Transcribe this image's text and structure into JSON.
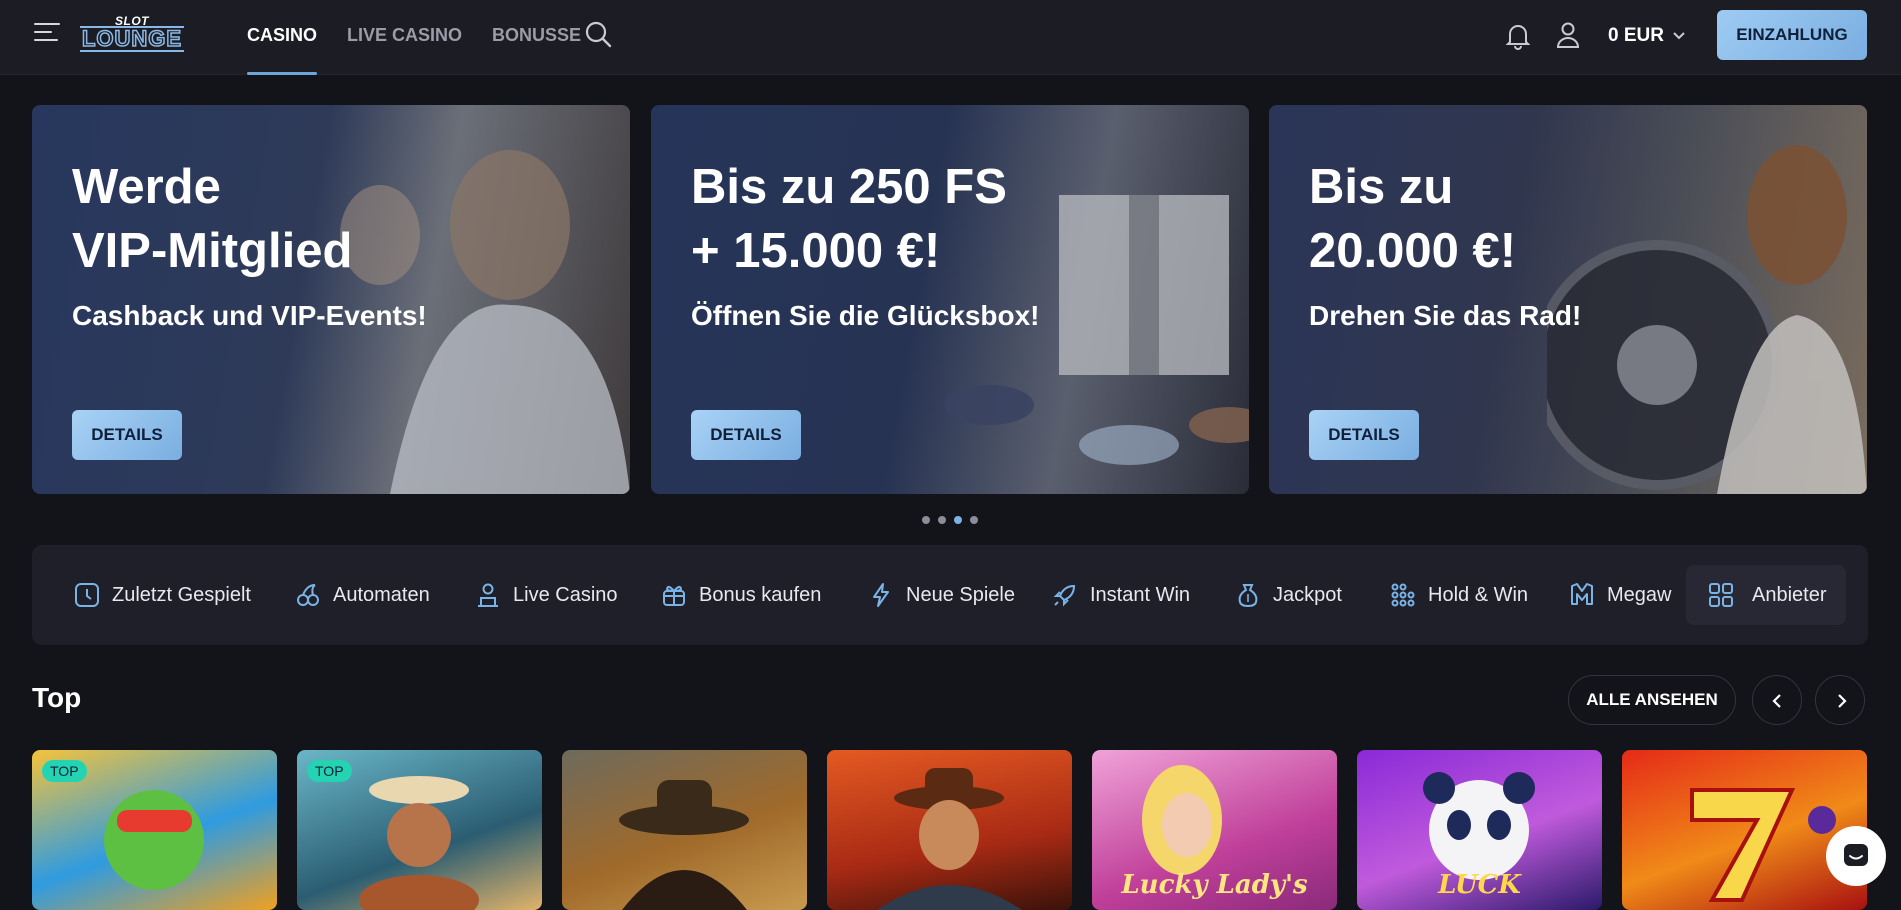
{
  "header": {
    "logo_top": "SLOT",
    "logo_main": "LOUNGE",
    "nav": [
      "CASINO",
      "LIVE CASINO",
      "BONUSSE"
    ],
    "balance": "0 EUR",
    "deposit": "EINZAHLUNG"
  },
  "banners": [
    {
      "title": "Werde\nVIP-Mitglied",
      "subtitle": "Cashback und VIP-Events!",
      "button": "DETAILS"
    },
    {
      "title": "Bis zu 250 FS\n+ 15.000 €!",
      "subtitle": "Öffnen Sie die Glücksbox!",
      "button": "DETAILS"
    },
    {
      "title": "Bis zu\n20.000 €!",
      "subtitle": "Drehen Sie das Rad!",
      "button": "DETAILS"
    }
  ],
  "carousel": {
    "dots": 4,
    "active": 2
  },
  "categories": [
    {
      "label": "Zuletzt Gespielt",
      "icon": "clock-icon"
    },
    {
      "label": "Automaten",
      "icon": "cherries-icon"
    },
    {
      "label": "Live Casino",
      "icon": "dealer-icon"
    },
    {
      "label": "Bonus kaufen",
      "icon": "gift-icon"
    },
    {
      "label": "Neue Spiele",
      "icon": "lightning-icon"
    },
    {
      "label": "Instant Win",
      "icon": "rocket-icon"
    },
    {
      "label": "Jackpot",
      "icon": "moneybag-icon"
    },
    {
      "label": "Hold & Win",
      "icon": "grid-dots-icon"
    },
    {
      "label": "Megaw",
      "icon": "megaways-icon"
    }
  ],
  "provider": {
    "label": "Anbieter",
    "icon": "grid-icon"
  },
  "top": {
    "title": "Top",
    "see_all": "ALLE ANSEHEN",
    "games": [
      {
        "badge": "TOP",
        "name": ""
      },
      {
        "badge": "TOP",
        "name": ""
      },
      {
        "badge": "",
        "name": ""
      },
      {
        "badge": "",
        "name": ""
      },
      {
        "badge": "",
        "name": "Lucky Lady's"
      },
      {
        "badge": "",
        "name": "LUCK"
      },
      {
        "badge": "",
        "name": ""
      }
    ]
  },
  "colors": {
    "accent": "#7aaee0",
    "badge": "#23d3b2",
    "background": "#13131a",
    "panel": "#1e1f28"
  }
}
